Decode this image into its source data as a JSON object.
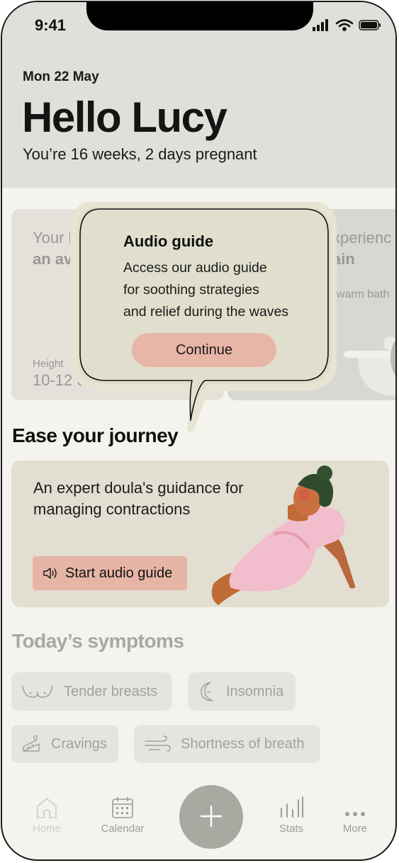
{
  "status": {
    "time": "9:41"
  },
  "header": {
    "date": "Mon 22 May",
    "greeting": "Hello Lucy",
    "pregnancy_status": "You’re 16 weeks, 2 days pregnant"
  },
  "cards": {
    "baby": {
      "line1": "Your b",
      "line2": "an av",
      "height_label": "Height",
      "height_value": "10-12 c"
    },
    "tip": {
      "line1": "xperienc",
      "line2": "ain",
      "line3": "r warm bath"
    }
  },
  "tooltip": {
    "title": "Audio guide",
    "lines": [
      "Access our audio guide",
      "for soothing strategies",
      "and relief during the waves"
    ],
    "button": "Continue"
  },
  "ease": {
    "title": "Ease your journey",
    "card_lines": [
      "An expert doula's guidance for",
      "managing contractions"
    ],
    "button": "Start audio guide"
  },
  "symptoms": {
    "title": "Today’s symptoms",
    "items": [
      {
        "label": "Tender breasts",
        "icon": "breasts-icon"
      },
      {
        "label": "Insomnia",
        "icon": "moon-icon"
      },
      {
        "label": "Cravings",
        "icon": "cake-icon"
      },
      {
        "label": "Shortness of breath",
        "icon": "wind-icon"
      }
    ]
  },
  "tabbar": {
    "items": [
      {
        "label": "Home",
        "icon": "home-icon"
      },
      {
        "label": "Calendar",
        "icon": "calendar-icon"
      },
      {
        "label": "Stats",
        "icon": "stats-icon"
      },
      {
        "label": "More",
        "icon": "more-icon"
      }
    ],
    "fab_icon": "plus-icon"
  }
}
